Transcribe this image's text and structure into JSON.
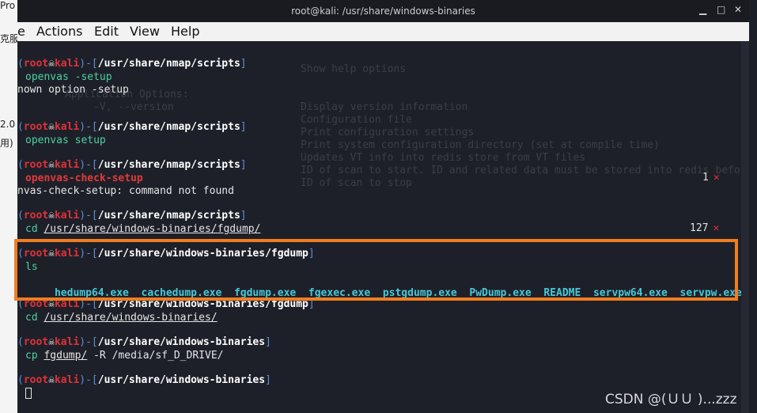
{
  "behind": {
    "fragments": [
      "Pro",
      "克服",
      "2.0",
      "用)"
    ]
  },
  "window": {
    "title": "root@kali: /usr/share/windows-binaries",
    "controls": [
      "▁",
      "□",
      "✕"
    ]
  },
  "menubar": {
    "items": [
      "e",
      "Actions",
      "Edit",
      "View",
      "Help"
    ]
  },
  "terminal": {
    "prompts": [
      {
        "user": "root",
        "host": "kali",
        "path": "/usr/share/nmap/scripts",
        "command": "openvas -setup",
        "output": "nown option -setup"
      },
      {
        "user": "root",
        "host": "kali",
        "path": "/usr/share/nmap/scripts",
        "command": "openvas setup",
        "output": ""
      },
      {
        "user": "root",
        "host": "kali",
        "path": "/usr/share/nmap/scripts",
        "command": "openvas-check-setup",
        "output": "nvas-check-setup: command not found",
        "status": "1"
      },
      {
        "user": "root",
        "host": "kali",
        "path": "/usr/share/nmap/scripts",
        "command_prefix": "cd ",
        "command_arg": "/usr/share/windows-binaries/fgdump/",
        "status": "127"
      },
      {
        "user": "root",
        "host": "kali",
        "path": "/usr/share/windows-binaries/fgdump",
        "command": "ls"
      },
      {
        "user": "root",
        "host": "kali",
        "path": "/usr/share/windows-binaries/fgdump",
        "command_prefix": "cd ",
        "command_arg": "/usr/share/windows-binaries/"
      },
      {
        "user": "root",
        "host": "kali",
        "path": "/usr/share/windows-binaries",
        "command_prefix": "cp ",
        "command_arg": "fgdump/",
        "command_suffix": " -R /media/sf_D_DRIVE/"
      },
      {
        "user": "root",
        "host": "kali",
        "path": "/usr/share/windows-binaries"
      }
    ],
    "ls_output": [
      "hedump64.exe",
      "cachedump.exe",
      "fgdump.exe",
      "fgexec.exe",
      "pstgdump.exe",
      "PwDump.exe",
      "README",
      "servpw64.exe",
      "servpw.exe"
    ],
    "ghost_text": [
      "Show help options",
      "Application Options:",
      "-V, --version",
      "Display version information",
      "Configuration file",
      "Print configuration settings",
      "Print system configuration directory (set at compile time)",
      "Updates VT info into redis store from VT files",
      "ID of scan to start. ID and related data must be stored into redis befor",
      "ID of scan to stop"
    ]
  },
  "watermark": "CSDN @(ＵＵ )...zzz",
  "colors": {
    "highlight_border": "#f07d20",
    "prompt_bracket": "#5d8cd8",
    "prompt_user": "#e0323a",
    "ls_files": "#47c8d8"
  }
}
